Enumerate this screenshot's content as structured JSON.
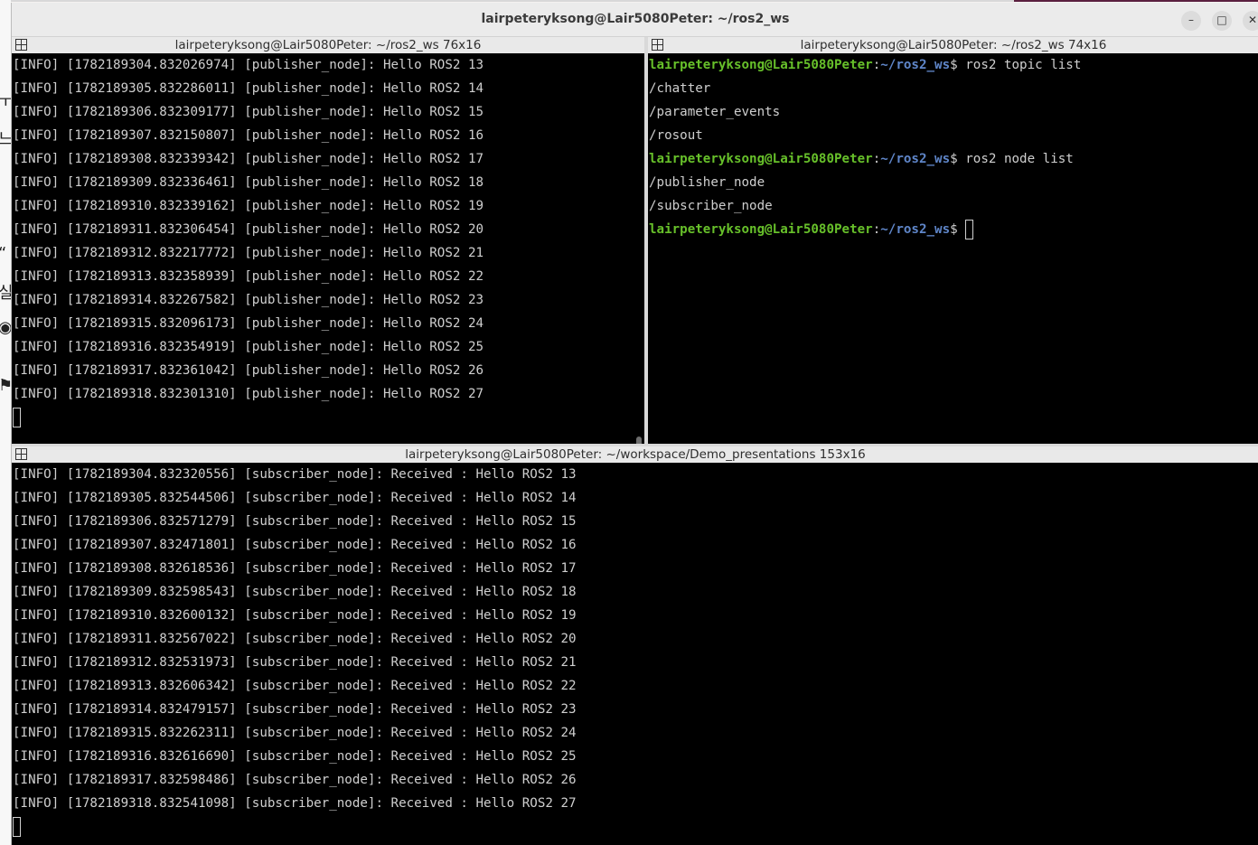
{
  "window": {
    "title": "lairpeteryksong@Lair5080Peter: ~/ros2_ws",
    "minimize_glyph": "–",
    "maximize_glyph": "□",
    "close_glyph": "✕"
  },
  "background_glyphs": [
    "ㅜ",
    "‹",
    "느",
    "“",
    "실",
    "◉",
    "⚑"
  ],
  "panes": {
    "left": {
      "header": "lairpeteryksong@Lair5080Peter: ~/ros2_ws 76x16",
      "header_icon": "split-terminal-icon",
      "lines": [
        "[INFO] [1782189304.832026974] [publisher_node]: Hello ROS2 13",
        "[INFO] [1782189305.832286011] [publisher_node]: Hello ROS2 14",
        "[INFO] [1782189306.832309177] [publisher_node]: Hello ROS2 15",
        "[INFO] [1782189307.832150807] [publisher_node]: Hello ROS2 16",
        "[INFO] [1782189308.832339342] [publisher_node]: Hello ROS2 17",
        "[INFO] [1782189309.832336461] [publisher_node]: Hello ROS2 18",
        "[INFO] [1782189310.832339162] [publisher_node]: Hello ROS2 19",
        "[INFO] [1782189311.832306454] [publisher_node]: Hello ROS2 20",
        "[INFO] [1782189312.832217772] [publisher_node]: Hello ROS2 21",
        "[INFO] [1782189313.832358939] [publisher_node]: Hello ROS2 22",
        "[INFO] [1782189314.832267582] [publisher_node]: Hello ROS2 23",
        "[INFO] [1782189315.832096173] [publisher_node]: Hello ROS2 24",
        "[INFO] [1782189316.832354919] [publisher_node]: Hello ROS2 25",
        "[INFO] [1782189317.832361042] [publisher_node]: Hello ROS2 26",
        "[INFO] [1782189318.832301310] [publisher_node]: Hello ROS2 27"
      ]
    },
    "right": {
      "header": "lairpeteryksong@Lair5080Peter: ~/ros2_ws 74x16",
      "header_icon": "split-terminal-icon",
      "prompt_user": "lairpeteryksong@Lair5080Peter",
      "prompt_sep": ":",
      "prompt_path": "~/ros2_ws",
      "prompt_dollar": "$ ",
      "cmd1": "ros2 topic list",
      "out1": [
        "/chatter",
        "/parameter_events",
        "/rosout"
      ],
      "cmd2": "ros2 node list",
      "out2": [
        "/publisher_node",
        "/subscriber_node"
      ]
    },
    "bottom": {
      "header": "lairpeteryksong@Lair5080Peter: ~/workspace/Demo_presentations 153x16",
      "header_icon": "split-terminal-icon",
      "lines": [
        "[INFO] [1782189304.832320556] [subscriber_node]: Received : Hello ROS2 13",
        "[INFO] [1782189305.832544506] [subscriber_node]: Received : Hello ROS2 14",
        "[INFO] [1782189306.832571279] [subscriber_node]: Received : Hello ROS2 15",
        "[INFO] [1782189307.832471801] [subscriber_node]: Received : Hello ROS2 16",
        "[INFO] [1782189308.832618536] [subscriber_node]: Received : Hello ROS2 17",
        "[INFO] [1782189309.832598543] [subscriber_node]: Received : Hello ROS2 18",
        "[INFO] [1782189310.832600132] [subscriber_node]: Received : Hello ROS2 19",
        "[INFO] [1782189311.832567022] [subscriber_node]: Received : Hello ROS2 20",
        "[INFO] [1782189312.832531973] [subscriber_node]: Received : Hello ROS2 21",
        "[INFO] [1782189313.832606342] [subscriber_node]: Received : Hello ROS2 22",
        "[INFO] [1782189314.832479157] [subscriber_node]: Received : Hello ROS2 23",
        "[INFO] [1782189315.832262311] [subscriber_node]: Received : Hello ROS2 24",
        "[INFO] [1782189316.832616690] [subscriber_node]: Received : Hello ROS2 25",
        "[INFO] [1782189317.832598486] [subscriber_node]: Received : Hello ROS2 26",
        "[INFO] [1782189318.832541098] [subscriber_node]: Received : Hello ROS2 27"
      ]
    }
  },
  "colors": {
    "prompt_user": "#67c02a",
    "prompt_path": "#5f86c9",
    "terminal_text": "#cfcfcf",
    "terminal_bg": "#000000"
  }
}
